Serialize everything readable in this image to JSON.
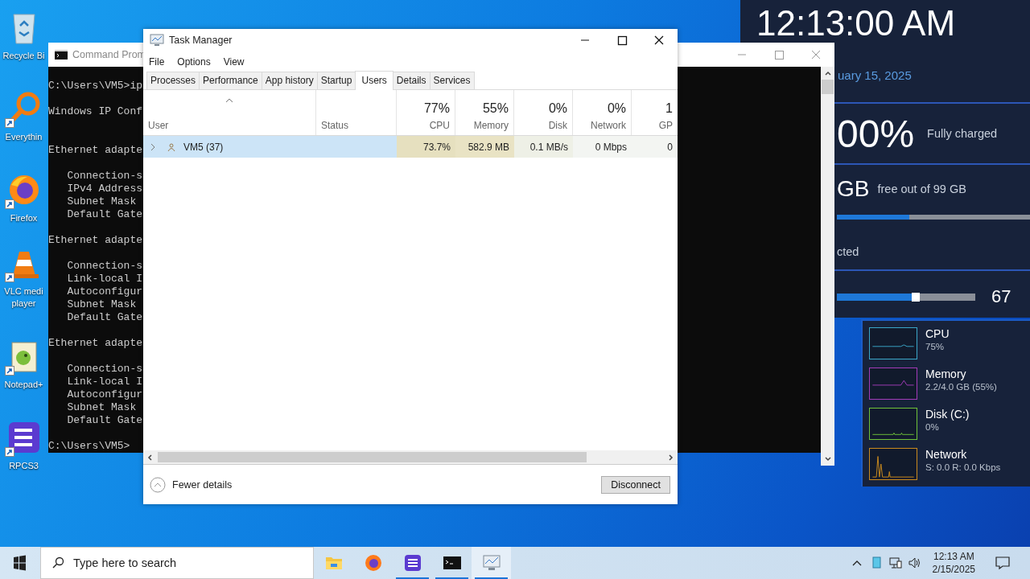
{
  "desktop_icons": [
    {
      "lines": [
        "Recycle Bi"
      ],
      "kind": "recycle",
      "shortcut": false
    },
    {
      "lines": [
        "Everythin"
      ],
      "kind": "magnifier",
      "shortcut": true
    },
    {
      "lines": [
        "Firefox"
      ],
      "kind": "firefox",
      "shortcut": true
    },
    {
      "lines": [
        "VLC medi",
        "player"
      ],
      "kind": "cone",
      "shortcut": true
    },
    {
      "lines": [
        "Notepad+"
      ],
      "kind": "notepad",
      "shortcut": true
    },
    {
      "lines": [
        "RPCS3"
      ],
      "kind": "rpcs3",
      "shortcut": true
    }
  ],
  "console": {
    "title": "Command Prom",
    "blocks": [
      [
        "C:\\Users\\VM5>ip"
      ],
      [
        "Windows IP Conf"
      ],
      [
        "Ethernet adapte"
      ],
      [
        "   Connection-s",
        "   IPv4 Address",
        "   Subnet Mask",
        "   Default Gate"
      ],
      [
        "Ethernet adapte"
      ],
      [
        "   Connection-s",
        "   Link-local I",
        "   Autoconfigur",
        "   Subnet Mask",
        "   Default Gate"
      ],
      [
        "Ethernet adapte"
      ],
      [
        "   Connection-s",
        "   Link-local I",
        "   Autoconfigur",
        "   Subnet Mask",
        "   Default Gate"
      ],
      [
        "C:\\Users\\VM5>"
      ]
    ]
  },
  "widget": {
    "clock": "12:13:00 AM",
    "date": "uary 15, 2025",
    "battery": {
      "value": "00%",
      "status": "Fully charged"
    },
    "storage": {
      "value": "GB",
      "caption": "free out of 99 GB",
      "level": 0.375
    },
    "network": {
      "status": "cted"
    },
    "volume": {
      "level": 0.55,
      "reading": "67"
    }
  },
  "monitors": [
    {
      "name": "CPU",
      "reading": "75%",
      "color": "#3aa6c8"
    },
    {
      "name": "Memory",
      "reading": "2.2/4.0 GB (55%)",
      "color": "#a23bb8"
    },
    {
      "name": "Disk (C:)",
      "reading": "0%",
      "color": "#6fc23a"
    },
    {
      "name": "Network",
      "reading": "S: 0.0 R: 0.0 Kbps",
      "color": "#c98a1e"
    }
  ],
  "task_manager": {
    "title": "Task Manager",
    "menu": [
      "File",
      "Options",
      "View"
    ],
    "tabs": [
      {
        "label": "Processes",
        "selected": false
      },
      {
        "label": "Performance",
        "selected": false
      },
      {
        "label": "App history",
        "selected": false
      },
      {
        "label": "Startup",
        "selected": false
      },
      {
        "label": "Users",
        "selected": true
      },
      {
        "label": "Details",
        "selected": false
      },
      {
        "label": "Services",
        "selected": false
      }
    ],
    "columns": [
      {
        "label": "User",
        "sorted": true
      },
      {
        "label": "Status",
        "sorted": false
      },
      {
        "label": "CPU",
        "total": "77%",
        "sorted": false
      },
      {
        "label": "Memory",
        "total": "55%",
        "sorted": false
      },
      {
        "label": "Disk",
        "total": "0%",
        "sorted": false
      },
      {
        "label": "Network",
        "total": "0%",
        "sorted": false
      },
      {
        "label": "GP",
        "total": "1",
        "sorted": false
      }
    ],
    "rows": [
      {
        "expanded": false,
        "selected": true,
        "cells": [
          {
            "text": "VM5 (37)"
          },
          {
            "text": ""
          },
          {
            "text": "73.7%",
            "color": "#e6e0bf"
          },
          {
            "text": "582.9 MB",
            "color": "#e9e3c4"
          },
          {
            "text": "0.1 MB/s",
            "color": "#eef0e6"
          },
          {
            "text": "0 Mbps",
            "color": "#f3f5f2"
          },
          {
            "text": "0",
            "color": "#f3f5f2"
          }
        ]
      }
    ],
    "toggle": "Fewer details",
    "button": "Disconnect"
  },
  "taskbar": {
    "search_placeholder": "Type here to search",
    "apps": [
      {
        "kind": "folder",
        "open": false,
        "selected": false
      },
      {
        "kind": "firefox",
        "open": false,
        "selected": false
      },
      {
        "kind": "rpcs3",
        "open": true,
        "selected": false
      },
      {
        "kind": "terminal",
        "open": true,
        "selected": false
      },
      {
        "kind": "monitor",
        "open": true,
        "selected": true
      }
    ],
    "time": "12:13 AM",
    "date": "2/15/2025"
  }
}
